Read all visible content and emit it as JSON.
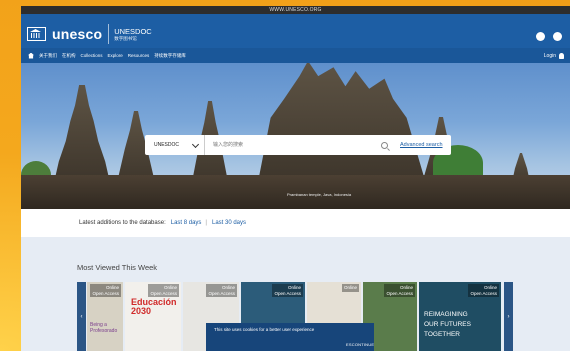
{
  "browser": {
    "url_strip": "WWW.UNESCO.ORG"
  },
  "header": {
    "logo_text": "unesco",
    "site_title": "UNESDOC",
    "site_subtitle": "数字图书馆"
  },
  "nav": {
    "items": [
      "关于我们",
      "在机构",
      "Collections",
      "Explore",
      "Resources",
      "持续数字存储库"
    ],
    "login_label": "Login"
  },
  "search": {
    "scope_value": "UNESDOC",
    "placeholder": "输入您的搜索",
    "advanced_label": "Advanced search"
  },
  "hero": {
    "caption": "Prambanan temple, Java, Indonesia"
  },
  "latest": {
    "label": "Latest additions to the database:",
    "link_8": "Last 8 days",
    "separator": "|",
    "link_30": "Last 30 days"
  },
  "most_viewed": {
    "title": "Most Viewed This Week",
    "books": [
      {
        "open_access": "Online\nOpen Access",
        "text": "Being a\nProfesorado",
        "bg": "#d7d2c4"
      },
      {
        "open_access": "Online\nOpen Access",
        "text": "Educación\n2030",
        "bg": "#f2f0ec"
      },
      {
        "open_access": "Online\nOpen Access",
        "text": "",
        "bg": "#e7e6e2"
      },
      {
        "open_access": "Online\nOpen Access",
        "text": "",
        "bg": "#2c5c7a"
      },
      {
        "open_access": "Online",
        "text": "",
        "bg": "#e5e0d5"
      },
      {
        "open_access": "Online\nOpen Access",
        "text": "",
        "bg": "#5a7c4b"
      },
      {
        "open_access": "Online\nOpen Access",
        "text": "REIMAGINING\nOUR FUTURES\nTOGETHER",
        "bg": "#1f4d63"
      }
    ]
  },
  "cookie": {
    "message": "This site uses cookies for a better user experience",
    "button": "ESCONTINUE"
  },
  "colors": {
    "brand_blue": "#1d5ea4",
    "nav_blue": "#1a5799",
    "page_bg": "#f2a51c"
  }
}
